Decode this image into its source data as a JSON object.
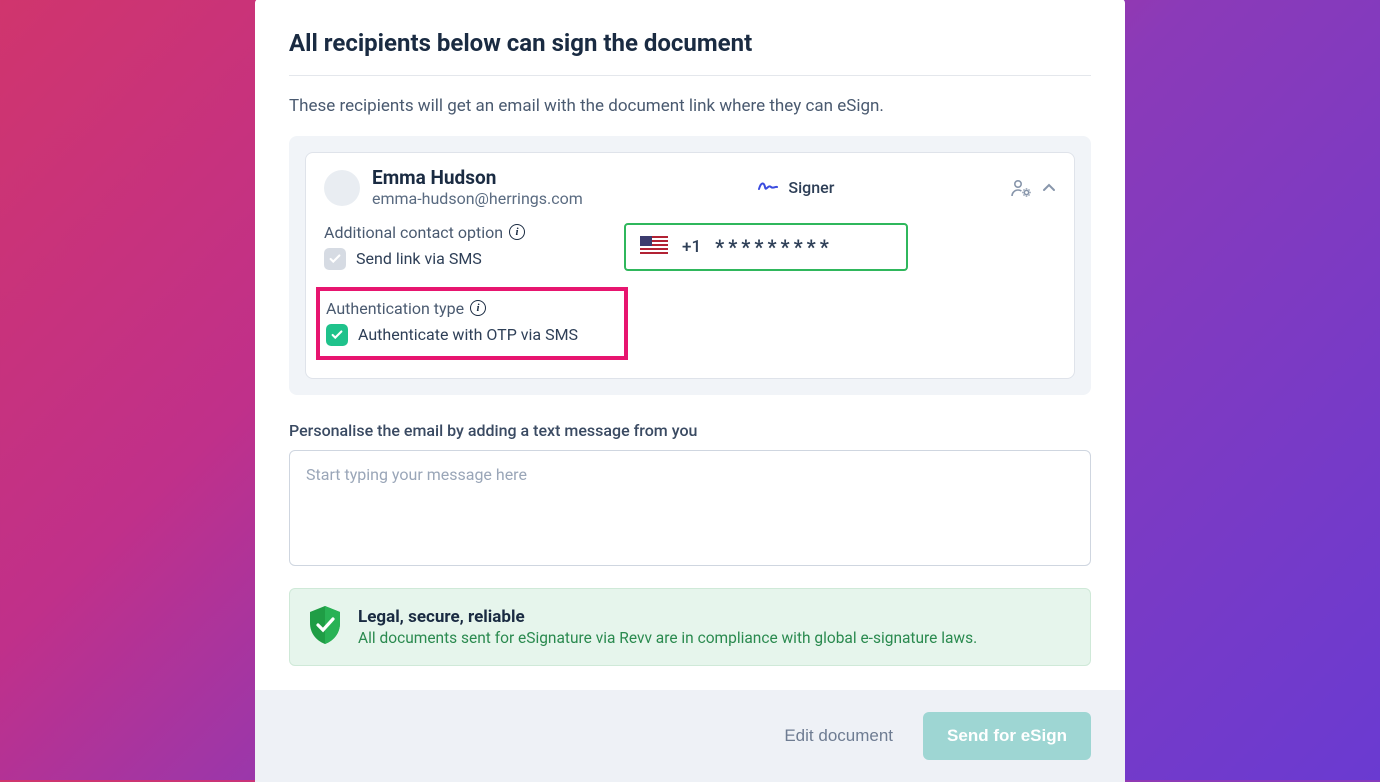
{
  "modal": {
    "title": "All recipients below can sign the document",
    "subtitle": "These recipients will get an email with the document link where they can eSign."
  },
  "recipient": {
    "name": "Emma Hudson",
    "email": "emma-hudson@herrings.com",
    "role": "Signer",
    "contact_option_label": "Additional contact option",
    "sms_link_label": "Send link via SMS",
    "auth_type_label": "Authentication type",
    "auth_otp_label": "Authenticate with OTP via SMS",
    "phone_prefix": "+1",
    "phone_masked": "*********"
  },
  "message": {
    "label": "Personalise the email by adding a text message from you",
    "placeholder": "Start typing your message here"
  },
  "legal": {
    "title": "Legal, secure, reliable",
    "subtitle": "All documents sent for eSignature via Revv are in compliance with global e-signature laws."
  },
  "footer": {
    "edit": "Edit document",
    "send": "Send for eSign"
  }
}
